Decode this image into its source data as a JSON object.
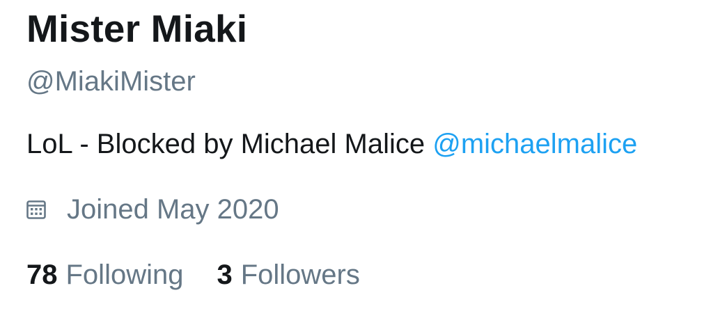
{
  "profile": {
    "display_name": "Mister Miaki",
    "handle": "@MiakiMister",
    "bio": {
      "text": "LoL - Blocked by Michael Malice ",
      "mention": "@michaelmalice"
    },
    "joined": {
      "icon": "calendar-icon",
      "text": "Joined May 2020"
    },
    "stats": {
      "following_count": "78",
      "following_label": "Following",
      "followers_count": "3",
      "followers_label": "Followers"
    }
  },
  "colors": {
    "text_primary": "#14171a",
    "text_secondary": "#657786",
    "link": "#1da1f2"
  }
}
